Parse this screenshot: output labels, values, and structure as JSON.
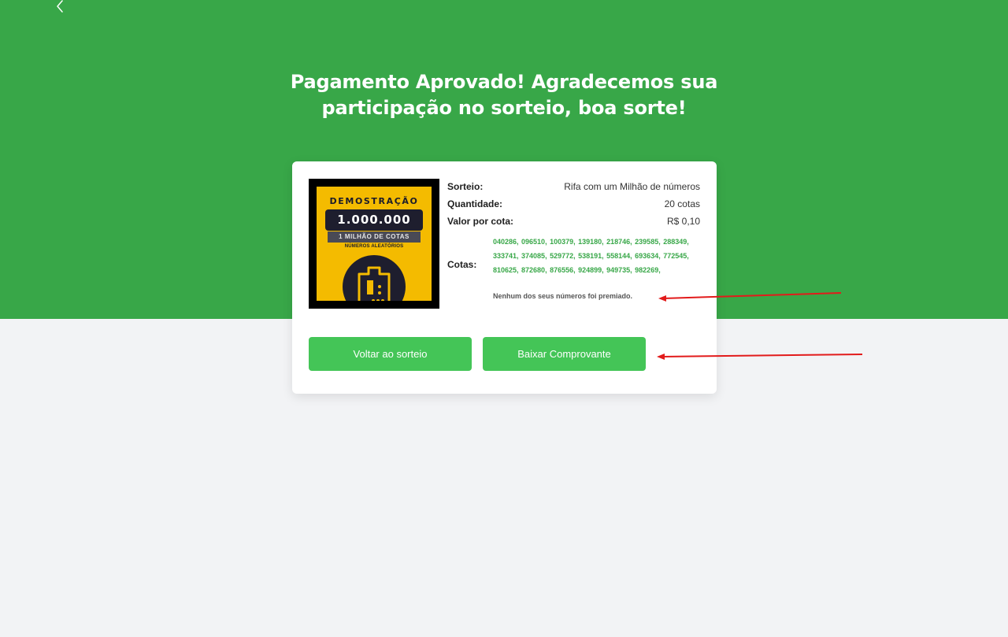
{
  "header": {
    "back_icon": "chevron-left-icon",
    "title": "Pagamento Aprovado! Agradecemos sua participação no sorteio, boa sorte!"
  },
  "colors": {
    "brand_green": "#38a748",
    "button_green": "#44c557",
    "page_bg": "#f2f3f5",
    "annotation_arrow": "#e21b1b"
  },
  "thumbnail": {
    "demo_text": "DEMOSTRAÇÃO",
    "count_text": "1.000.000",
    "million_text": "1 MILHÃO DE COTAS",
    "random_text": "NÚMEROS ALEATÓRIOS",
    "icon": "ticket-icon"
  },
  "order": {
    "sorteio_label": "Sorteio:",
    "sorteio_value": "Rifa com um Milhão de números",
    "quantidade_label": "Quantidade:",
    "quantidade_value": "20 cotas",
    "valor_label": "Valor por cota:",
    "valor_value": "R$ 0,10",
    "cotas_label": "Cotas:",
    "cotas_numbers": "040286, 096510, 100379, 139180, 218746, 239585, 288349, 333741, 374085, 529772, 538191, 558144, 693634, 772545, 810625, 872680, 876556, 924899, 949735, 982269,",
    "no_prize_text": "Nenhum dos seus números foi premiado."
  },
  "actions": {
    "back_label": "Voltar ao sorteio",
    "receipt_label": "Baixar Comprovante"
  }
}
